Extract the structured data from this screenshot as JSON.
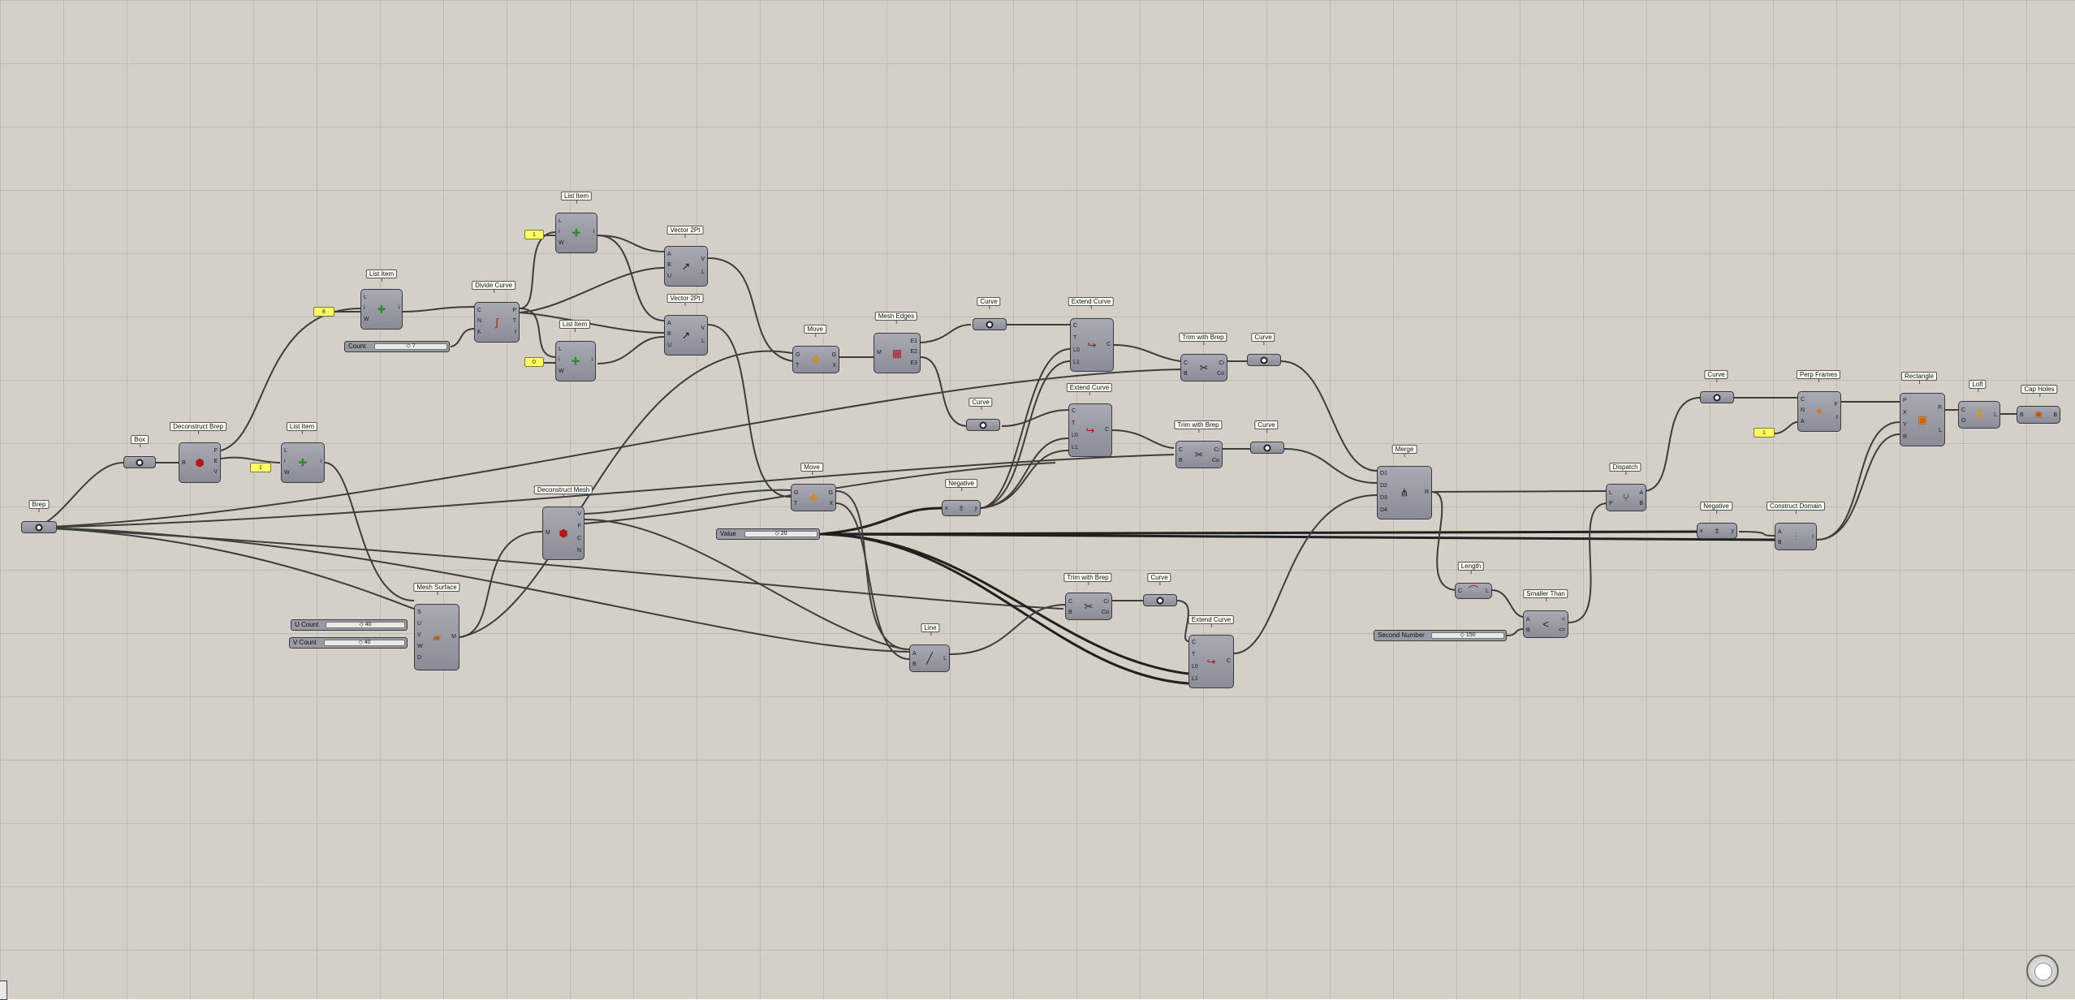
{
  "canvas": {
    "background": "#d4d0c8",
    "grid_color": "#a8a69c"
  },
  "nodes": [
    {
      "id": "brep",
      "label": "Brep",
      "type": "param",
      "icon": "brep-icon"
    },
    {
      "id": "box",
      "label": "Box",
      "type": "param",
      "icon": "box-icon"
    },
    {
      "id": "deconstruct_brep",
      "label": "Deconstruct Brep",
      "inputs": [
        "B"
      ],
      "outputs": [
        "F",
        "E",
        "V"
      ],
      "icon": "deconstruct-brep-icon"
    },
    {
      "id": "list_item_1",
      "label": "List Item",
      "inputs": [
        "L",
        "i",
        "W"
      ],
      "outputs": [
        "i"
      ],
      "icon": "list-item-icon"
    },
    {
      "id": "list_item_2",
      "label": "List Item",
      "inputs": [
        "L",
        "i",
        "W"
      ],
      "outputs": [
        "i"
      ],
      "icon": "list-item-icon"
    },
    {
      "id": "divide_curve",
      "label": "Divide Curve",
      "inputs": [
        "C",
        "N",
        "K"
      ],
      "outputs": [
        "P",
        "T",
        "t"
      ],
      "icon": "divide-curve-icon"
    },
    {
      "id": "list_item_3",
      "label": "List Item",
      "inputs": [
        "L",
        "i",
        "W"
      ],
      "outputs": [
        "i"
      ],
      "icon": "list-item-icon"
    },
    {
      "id": "list_item_4",
      "label": "List Item",
      "inputs": [
        "L",
        "i",
        "W"
      ],
      "outputs": [
        "i"
      ],
      "icon": "list-item-icon"
    },
    {
      "id": "vector_2pt_1",
      "label": "Vector 2Pt",
      "inputs": [
        "A",
        "B",
        "U"
      ],
      "outputs": [
        "V",
        "L"
      ],
      "icon": "vector-icon"
    },
    {
      "id": "vector_2pt_2",
      "label": "Vector 2Pt",
      "inputs": [
        "A",
        "B",
        "U"
      ],
      "outputs": [
        "V",
        "L"
      ],
      "icon": "vector-icon"
    },
    {
      "id": "move_1",
      "label": "Move",
      "inputs": [
        "G",
        "T"
      ],
      "outputs": [
        "G",
        "X"
      ],
      "icon": "move-icon"
    },
    {
      "id": "mesh_edges",
      "label": "Mesh Edges",
      "inputs": [
        "M"
      ],
      "outputs": [
        "E1",
        "E2",
        "E3"
      ],
      "icon": "mesh-edges-icon"
    },
    {
      "id": "curve_1",
      "label": "Curve",
      "type": "param",
      "icon": "curve-icon"
    },
    {
      "id": "curve_2",
      "label": "Curve",
      "type": "param",
      "icon": "curve-icon"
    },
    {
      "id": "extend_curve_1",
      "label": "Extend Curve",
      "inputs": [
        "C",
        "T",
        "L0",
        "L1"
      ],
      "outputs": [
        "C"
      ],
      "icon": "extend-curve-icon"
    },
    {
      "id": "extend_curve_2",
      "label": "Extend Curve",
      "inputs": [
        "C",
        "T",
        "L0",
        "L1"
      ],
      "outputs": [
        "C"
      ],
      "icon": "extend-curve-icon"
    },
    {
      "id": "trim_brep_1",
      "label": "Trim with Brep",
      "inputs": [
        "C",
        "B"
      ],
      "outputs": [
        "Ci",
        "Co"
      ],
      "icon": "trim-brep-icon"
    },
    {
      "id": "trim_brep_2",
      "label": "Trim with Brep",
      "inputs": [
        "C",
        "B"
      ],
      "outputs": [
        "Ci",
        "Co"
      ],
      "icon": "trim-brep-icon"
    },
    {
      "id": "curve_3",
      "label": "Curve",
      "type": "param",
      "icon": "curve-icon"
    },
    {
      "id": "curve_4",
      "label": "Curve",
      "type": "param",
      "icon": "curve-icon"
    },
    {
      "id": "deconstruct_mesh",
      "label": "Deconstruct Mesh",
      "inputs": [
        "M"
      ],
      "outputs": [
        "V",
        "F",
        "C",
        "N"
      ],
      "icon": "deconstruct-mesh-icon"
    },
    {
      "id": "move_2",
      "label": "Move",
      "inputs": [
        "G",
        "T"
      ],
      "outputs": [
        "G",
        "X"
      ],
      "icon": "move-icon"
    },
    {
      "id": "negative_1",
      "label": "Negative",
      "inputs": [
        "x"
      ],
      "outputs": [
        "y"
      ],
      "icon": "negative-icon"
    },
    {
      "id": "mesh_surface",
      "label": "Mesh Surface",
      "inputs": [
        "S",
        "U",
        "V",
        "W",
        "D"
      ],
      "outputs": [
        "M"
      ],
      "icon": "mesh-surface-icon"
    },
    {
      "id": "trim_brep_3",
      "label": "Trim with Brep",
      "inputs": [
        "C",
        "B"
      ],
      "outputs": [
        "Ci",
        "Co"
      ],
      "icon": "trim-brep-icon"
    },
    {
      "id": "curve_5",
      "label": "Curve",
      "type": "param",
      "icon": "curve-icon"
    },
    {
      "id": "line",
      "label": "Line",
      "inputs": [
        "A",
        "B"
      ],
      "outputs": [
        "L"
      ],
      "icon": "line-icon"
    },
    {
      "id": "extend_curve_3",
      "label": "Extend Curve",
      "inputs": [
        "C",
        "T",
        "L0",
        "L1"
      ],
      "outputs": [
        "C"
      ],
      "icon": "extend-curve-icon"
    },
    {
      "id": "merge",
      "label": "Merge",
      "inputs": [
        "D1",
        "D2",
        "D3",
        "D4"
      ],
      "outputs": [
        "R"
      ],
      "icon": "merge-icon"
    },
    {
      "id": "length",
      "label": "Length",
      "inputs": [
        "C"
      ],
      "outputs": [
        "L"
      ],
      "icon": "length-icon"
    },
    {
      "id": "smaller_than",
      "label": "Smaller Than",
      "inputs": [
        "A",
        "B"
      ],
      "outputs": [
        "<",
        "<="
      ],
      "icon": "smaller-than-icon"
    },
    {
      "id": "dispatch",
      "label": "Dispatch",
      "inputs": [
        "L",
        "P"
      ],
      "outputs": [
        "A",
        "B"
      ],
      "icon": "dispatch-icon"
    },
    {
      "id": "curve_6",
      "label": "Curve",
      "type": "param",
      "icon": "curve-icon"
    },
    {
      "id": "perp_frames",
      "label": "Perp Frames",
      "inputs": [
        "C",
        "N",
        "A"
      ],
      "outputs": [
        "F",
        "t"
      ],
      "icon": "perp-frames-icon"
    },
    {
      "id": "negative_2",
      "label": "Negative",
      "inputs": [
        "x"
      ],
      "outputs": [
        "y"
      ],
      "icon": "negative-icon"
    },
    {
      "id": "construct_domain",
      "label": "Construct Domain",
      "inputs": [
        "A",
        "B"
      ],
      "outputs": [
        "I"
      ],
      "icon": "construct-domain-icon"
    },
    {
      "id": "rectangle",
      "label": "Rectangle",
      "inputs": [
        "P",
        "X",
        "Y",
        "R"
      ],
      "outputs": [
        "R",
        "L"
      ],
      "icon": "rectangle-icon"
    },
    {
      "id": "loft",
      "label": "Loft",
      "inputs": [
        "C",
        "O"
      ],
      "outputs": [
        "L"
      ],
      "icon": "loft-icon"
    },
    {
      "id": "cap_holes",
      "label": "Cap Holes",
      "inputs": [
        "B"
      ],
      "outputs": [
        "B"
      ],
      "icon": "cap-holes-icon"
    }
  ],
  "panels": [
    {
      "id": "panel_8",
      "text": "8"
    },
    {
      "id": "panel_1a",
      "text": "1"
    },
    {
      "id": "panel_0",
      "text": "0"
    },
    {
      "id": "panel_1b",
      "text": "1"
    },
    {
      "id": "panel_1c",
      "text": "1"
    }
  ],
  "sliders": [
    {
      "id": "count",
      "name": "Count",
      "value": "7"
    },
    {
      "id": "u_count",
      "name": "U Count",
      "value": "40"
    },
    {
      "id": "v_count",
      "name": "V Count",
      "value": "40"
    },
    {
      "id": "value",
      "name": "Value",
      "value": "20"
    },
    {
      "id": "second_number",
      "name": "Second Number",
      "value": "150"
    }
  ]
}
